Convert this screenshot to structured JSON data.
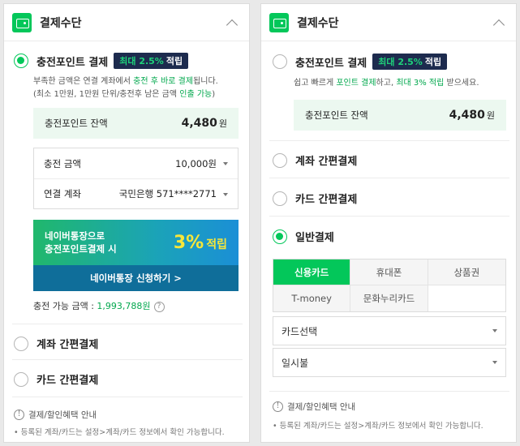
{
  "left": {
    "header_title": "결제수단",
    "charge_point": {
      "label": "충전포인트 결제",
      "badge_highlight": "최대 2.5%",
      "badge_suffix": "적립",
      "note1_a": "부족한 금액은 연결 계좌에서 ",
      "note1_b": "충전 후 바로 결제",
      "note1_c": "됩니다.",
      "note2_a": "(최소 1만원, 1만원 단위/충전후 남은 금액 ",
      "note2_b": "인출 가능",
      "note2_c": ")",
      "balance_label": "충전포인트 잔액",
      "balance_value": "4,480",
      "balance_unit": "원",
      "amount_label": "충전 금액",
      "amount_value": "10,000원",
      "account_label": "연결 계좌",
      "account_value": "국민은행 571****2771"
    },
    "promo": {
      "line1": "네이버통장으로",
      "line2": "충전포인트결제 시",
      "big": "3%",
      "big_suffix": "적립",
      "button": "네이버통장 신청하기 >"
    },
    "chargeable_label": "충전 가능 금액 : ",
    "chargeable_value": "1,993,788원",
    "help_icon": "?",
    "options": [
      "계좌 간편결제",
      "카드 간편결제"
    ],
    "info_icon": "!",
    "info_title": "결제/할인혜택 안내",
    "foot": "• 등록된 계좌/카드는 설정>계좌/카드 정보에서 확인 가능합니다."
  },
  "right": {
    "header_title": "결제수단",
    "charge_point": {
      "label": "충전포인트 결제",
      "badge_highlight": "최대 2.5%",
      "badge_suffix": "적립",
      "note_a": "쉽고 빠르게 ",
      "note_b": "포인트 결제",
      "note_c": "하고, ",
      "note_d": "최대 3% 적립",
      "note_e": " 받으세요.",
      "balance_label": "충전포인트 잔액",
      "balance_value": "4,480",
      "balance_unit": "원"
    },
    "options": [
      "계좌 간편결제",
      "카드 간편결제",
      "일반결제"
    ],
    "tabs": [
      "신용카드",
      "휴대폰",
      "상품권",
      "T-money",
      "문화누리카드"
    ],
    "card_select": "카드선택",
    "installment": "일시불",
    "info_icon": "!",
    "info_title": "결제/할인혜택 안내",
    "foot": "• 등록된 계좌/카드는 설정>계좌/카드 정보에서 확인 가능합니다."
  },
  "colors": {
    "accent": "#03c75a",
    "badge_bg": "#1d2b4e",
    "promo_yellow": "#f7e63a"
  },
  "icons": [
    "wallet-icon",
    "chevron-up-icon",
    "caret-down-icon",
    "info-icon",
    "help-icon"
  ]
}
